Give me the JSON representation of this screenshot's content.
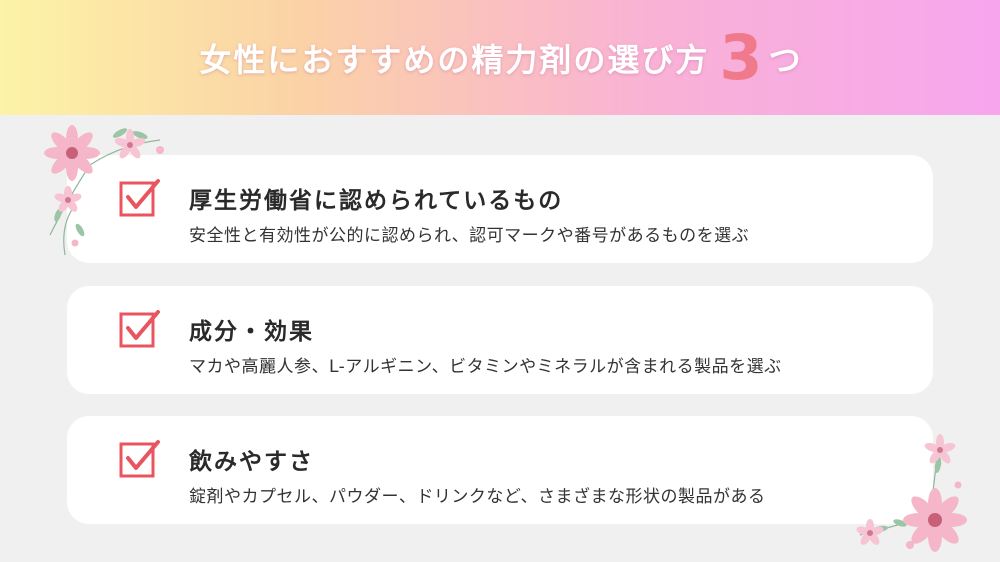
{
  "header": {
    "title_main": "女性におすすめの精力剤の選び方",
    "title_number": "3",
    "title_suffix": "つ"
  },
  "colors": {
    "accent": "#e8555f",
    "number": "#f07a8c",
    "header_gradient": [
      "#fcf3a7",
      "#fbd2a6",
      "#f9b2d5",
      "#f7a6ee"
    ],
    "background": "#f0f0f0",
    "card": "#ffffff"
  },
  "items": [
    {
      "icon": "checkbox-checked-icon",
      "title": "厚生労働省に認められているもの",
      "description": "安全性と有効性が公的に認められ、認可マークや番号があるものを選ぶ"
    },
    {
      "icon": "checkbox-checked-icon",
      "title": "成分・効果",
      "description": "マカや高麗人参、L-アルギニン、ビタミンやミネラルが含まれる製品を選ぶ"
    },
    {
      "icon": "checkbox-checked-icon",
      "title": "飲みやすさ",
      "description": "錠剤やカプセル、パウダー、ドリンクなど、さまざまな形状の製品がある"
    }
  ]
}
